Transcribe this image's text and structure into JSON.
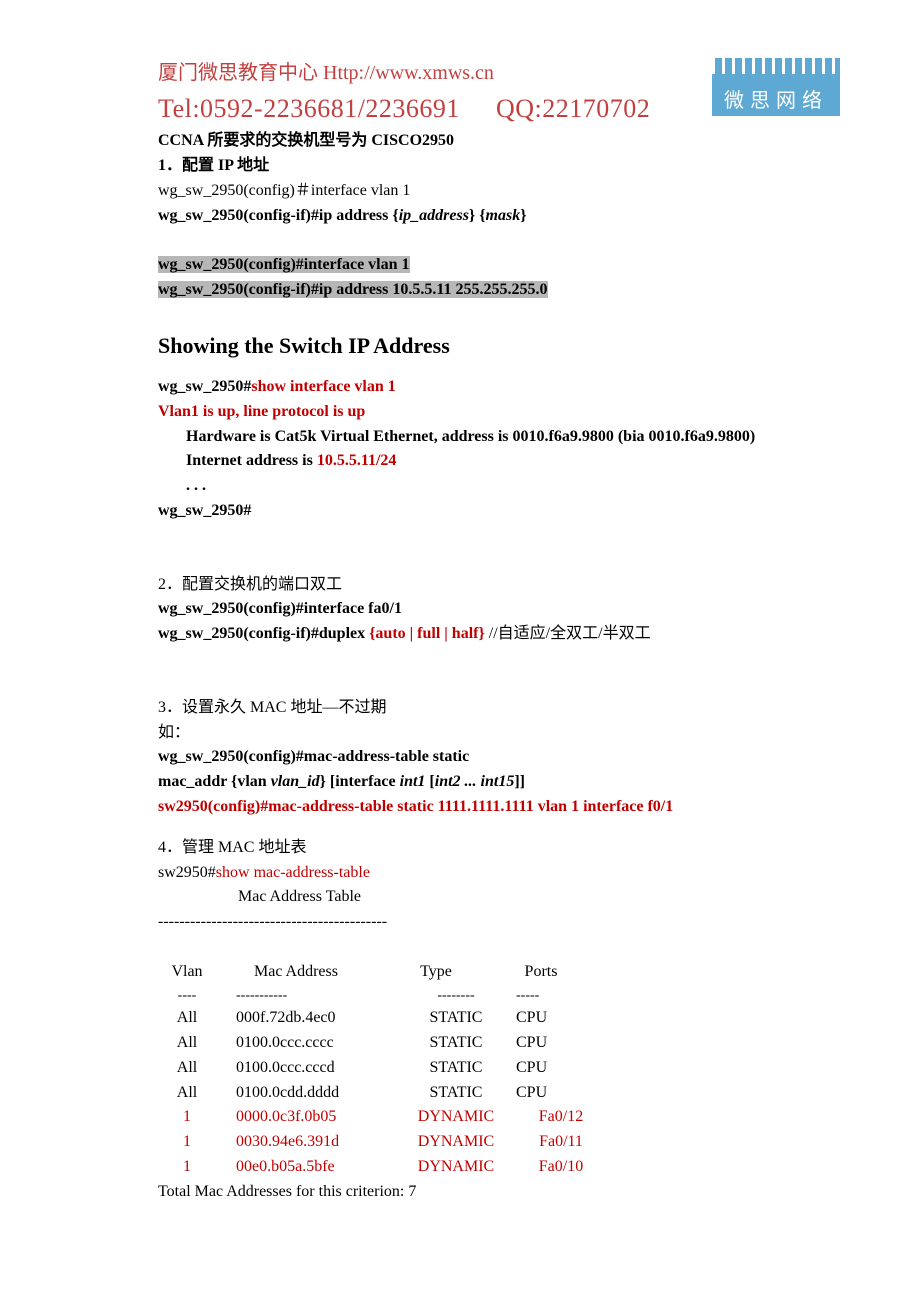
{
  "header": {
    "line1_a": "厦门微思教育中心",
    "line1_b": "Http://www.xmws.cn",
    "line2_a": "Tel:0592-2236681/2236691",
    "line2_b": "QQ:22170702",
    "logo_text": "微思网络"
  },
  "intro": {
    "title": "CCNA 所要求的交换机型号为 CISCO2950",
    "s1_title": "1．配置 IP 地址",
    "s1_l1": "wg_sw_2950(config)＃interface vlan 1",
    "s1_l2a": "wg_sw_2950(config-if)#ip address {",
    "s1_l2b": "ip_address",
    "s1_l2c": "} {",
    "s1_l2d": "mask",
    "s1_l2e": "}",
    "s1_hl1": "wg_sw_2950(config)#interface vlan 1",
    "s1_hl2": "wg_sw_2950(config-if)#ip address 10.5.5.11 255.255.255.0"
  },
  "show_ip": {
    "heading": "Showing the Switch IP Address",
    "l1a": "wg_sw_2950#",
    "l1b": "show interface vlan 1",
    "l2": "Vlan1 is up, line protocol is up",
    "l3": "Hardware is Cat5k Virtual Ethernet, address is 0010.f6a9.9800 (bia 0010.f6a9.9800)",
    "l4a": "Internet address is ",
    "l4b": "10.5.5.11/24",
    "dots": ". . .",
    "l5": "wg_sw_2950#"
  },
  "s2": {
    "title": "2．配置交换机的端口双工",
    "l1": "wg_sw_2950(config)#interface fa0/1",
    "l2a": "wg_sw_2950(config-if)#duplex ",
    "l2b": "{auto | full | half} ",
    "l2c": "//自适应/全双工/半双工"
  },
  "s3": {
    "title_a": "3．设置永久 MAC 地址",
    "title_b": "—不过期",
    "l0": "如：",
    "l1": "wg_sw_2950(config)#mac-address-table static",
    "l2a": "mac_addr {vlan ",
    "l2b": "vlan_id",
    "l2c": "} [interface ",
    "l2d": "int1 ",
    "l2e": "[",
    "l2f": "int2 ... int15",
    "l2g": "]]",
    "l3": "sw2950(config)#mac-address-table static 1111.1111.1111 vlan 1 interface f0/1"
  },
  "s4": {
    "title": "4．管理 MAC 地址表",
    "l1a": "sw2950#",
    "l1b": "show    mac-address-table",
    "l2": "Mac Address Table",
    "dash": "-------------------------------------------",
    "hdr_vlan": "Vlan",
    "hdr_mac": "Mac Address",
    "hdr_type": "Type",
    "hdr_ports": "Ports",
    "d1": "----",
    "d2": "-----------",
    "d3": "--------",
    "d4": "-----",
    "rows": [
      {
        "v": "All",
        "m": "000f.72db.4ec0",
        "t": "STATIC",
        "p": "CPU",
        "red": false
      },
      {
        "v": "All",
        "m": "0100.0ccc.cccc",
        "t": "STATIC",
        "p": "CPU",
        "red": false
      },
      {
        "v": "All",
        "m": "0100.0ccc.cccd",
        "t": "STATIC",
        "p": "CPU",
        "red": false
      },
      {
        "v": "All",
        "m": "0100.0cdd.dddd",
        "t": "STATIC",
        "p": "CPU",
        "red": false
      },
      {
        "v": "1",
        "m": "0000.0c3f.0b05",
        "t": "DYNAMIC",
        "p": "Fa0/12",
        "red": true
      },
      {
        "v": "1",
        "m": "0030.94e6.391d",
        "t": "DYNAMIC",
        "p": "Fa0/11",
        "red": true
      },
      {
        "v": "1",
        "m": "00e0.b05a.5bfe",
        "t": "DYNAMIC",
        "p": "Fa0/10",
        "red": true
      }
    ],
    "total": "Total Mac Addresses for this criterion: 7"
  }
}
